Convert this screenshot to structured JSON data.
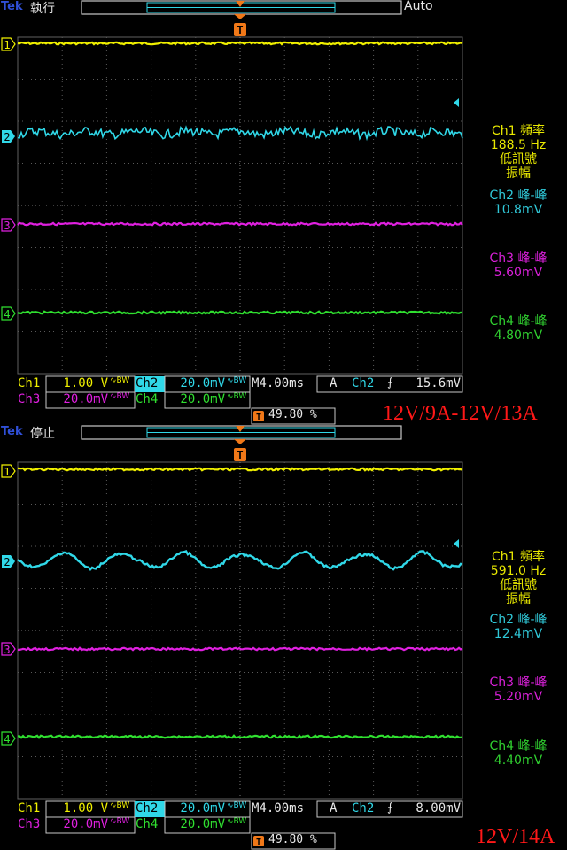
{
  "panels": [
    {
      "brand": "Tek",
      "run_state": "執行",
      "acq_mode": "Auto",
      "measurements": {
        "ch1": {
          "label": "Ch1 頻率",
          "value": "188.5 Hz",
          "note1": "低訊號",
          "note2": "振幅"
        },
        "ch2": {
          "label": "Ch2 峰-峰",
          "value": "10.8mV"
        },
        "ch3": {
          "label": "Ch3 峰-峰",
          "value": "5.60mV"
        },
        "ch4": {
          "label": "Ch4 峰-峰",
          "value": "4.80mV"
        }
      },
      "status": {
        "ch1_label": "Ch1",
        "ch1_scale": "1.00 V",
        "ch2_label": "Ch2",
        "ch2_scale": "20.0mV",
        "ch3_label": "Ch3",
        "ch3_scale": "20.0mV",
        "ch4_label": "Ch4",
        "ch4_scale": "20.0mV",
        "timebase": "M4.00ms",
        "trig_mode": "A",
        "trig_source": "Ch2",
        "trig_level": "15.6mV",
        "trig_position": "49.80 %"
      },
      "caption": "12V/9A-12V/13A"
    },
    {
      "brand": "Tek",
      "run_state": "停止",
      "acq_mode": "",
      "measurements": {
        "ch1": {
          "label": "Ch1 頻率",
          "value": "591.0 Hz",
          "note1": "低訊號",
          "note2": "振幅"
        },
        "ch2": {
          "label": "Ch2 峰-峰",
          "value": "12.4mV"
        },
        "ch3": {
          "label": "Ch3 峰-峰",
          "value": "5.20mV"
        },
        "ch4": {
          "label": "Ch4 峰-峰",
          "value": "4.40mV"
        }
      },
      "status": {
        "ch1_label": "Ch1",
        "ch1_scale": "1.00 V",
        "ch2_label": "Ch2",
        "ch2_scale": "20.0mV",
        "ch3_label": "Ch3",
        "ch3_scale": "20.0mV",
        "ch4_label": "Ch4",
        "ch4_scale": "20.0mV",
        "timebase": "M4.00ms",
        "trig_mode": "A",
        "trig_source": "Ch2",
        "trig_level": "8.00mV",
        "trig_position": "49.80 %"
      },
      "caption": "12V/14A"
    }
  ],
  "channel_markers": [
    "1",
    "2",
    "3",
    "4"
  ],
  "trigger_marker": "T",
  "coupling_symbol": "∿BW",
  "slope_symbol": "⨍",
  "colors": {
    "ch1": "#f0f000",
    "ch2": "#30d8e8",
    "ch3": "#e020e0",
    "ch4": "#30e030",
    "brand": "#3050d8",
    "trigger": "#f07818",
    "caption": "#ff1818",
    "status_bg": "#c8c8c8"
  }
}
